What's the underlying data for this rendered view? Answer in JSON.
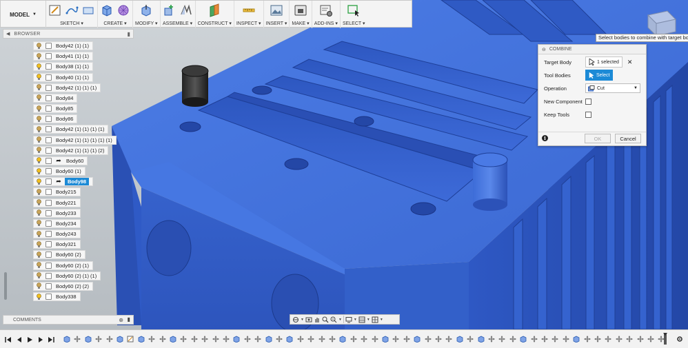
{
  "toolbar": {
    "workspace": "MODEL",
    "groups": [
      {
        "label": "SKETCH ▾"
      },
      {
        "label": "CREATE ▾"
      },
      {
        "label": "MODIFY ▾"
      },
      {
        "label": "ASSEMBLE ▾"
      },
      {
        "label": "CONSTRUCT ▾"
      },
      {
        "label": "INSPECT ▾"
      },
      {
        "label": "INSERT ▾"
      },
      {
        "label": "MAKE ▾"
      },
      {
        "label": "ADD-INS ▾"
      },
      {
        "label": "SELECT ▾"
      }
    ]
  },
  "browser": {
    "title": "BROWSER",
    "items": [
      {
        "label": "Body42 (1) (1)",
        "bulb": "off",
        "link": false,
        "selected": false
      },
      {
        "label": "Body41 (1) (1)",
        "bulb": "off",
        "link": false,
        "selected": false
      },
      {
        "label": "Body38 (1) (1)",
        "bulb": "on",
        "link": false,
        "selected": false
      },
      {
        "label": "Body40 (1) (1)",
        "bulb": "on",
        "link": false,
        "selected": false
      },
      {
        "label": "Body42 (1) (1) (1)",
        "bulb": "off",
        "link": false,
        "selected": false
      },
      {
        "label": "Body84",
        "bulb": "off",
        "link": false,
        "selected": false
      },
      {
        "label": "Body85",
        "bulb": "off",
        "link": false,
        "selected": false
      },
      {
        "label": "Body86",
        "bulb": "off",
        "link": false,
        "selected": false
      },
      {
        "label": "Body42 (1) (1) (1) (1)",
        "bulb": "off",
        "link": false,
        "selected": false
      },
      {
        "label": "Body42 (1) (1) (1) (1) (1)",
        "bulb": "off",
        "link": false,
        "selected": false
      },
      {
        "label": "Body42 (1) (1) (1) (2)",
        "bulb": "off",
        "link": false,
        "selected": false
      },
      {
        "label": "Body60",
        "bulb": "on",
        "link": true,
        "selected": false
      },
      {
        "label": "Body60 (1)",
        "bulb": "on",
        "link": false,
        "selected": false
      },
      {
        "label": "Body98",
        "bulb": "on",
        "link": true,
        "selected": true
      },
      {
        "label": "Body215",
        "bulb": "off",
        "link": false,
        "selected": false
      },
      {
        "label": "Body221",
        "bulb": "off",
        "link": false,
        "selected": false
      },
      {
        "label": "Body233",
        "bulb": "off",
        "link": false,
        "selected": false
      },
      {
        "label": "Body234",
        "bulb": "off",
        "link": false,
        "selected": false
      },
      {
        "label": "Body243",
        "bulb": "off",
        "link": false,
        "selected": false
      },
      {
        "label": "Body321",
        "bulb": "off",
        "link": false,
        "selected": false
      },
      {
        "label": "Body60 (2)",
        "bulb": "off",
        "link": false,
        "selected": false
      },
      {
        "label": "Body60 (2) (1)",
        "bulb": "off",
        "link": false,
        "selected": false
      },
      {
        "label": "Body60 (2) (1) (1)",
        "bulb": "off",
        "link": false,
        "selected": false
      },
      {
        "label": "Body60 (2) (2)",
        "bulb": "off",
        "link": false,
        "selected": false
      },
      {
        "label": "Body338",
        "bulb": "on",
        "link": false,
        "selected": false
      }
    ]
  },
  "comments": {
    "title": "COMMENTS"
  },
  "tooltip": "Select bodies to combine with target body",
  "combine": {
    "title": "COMBINE",
    "target_body_label": "Target Body",
    "target_body_value": "1 selected",
    "tool_bodies_label": "Tool Bodies",
    "tool_bodies_button": "Select",
    "operation_label": "Operation",
    "operation_value": "Cut",
    "new_component_label": "New Component",
    "keep_tools_label": "Keep Tools",
    "ok_label": "OK",
    "cancel_label": "Cancel"
  },
  "colors": {
    "model_blue": "#3f6fd8",
    "model_blue_dark": "#2447a6",
    "selection_blue": "#1c8ad6",
    "bulb_on": "#f2c01e",
    "bulb_off": "#c9a55a",
    "background_top": "#cfd4d8"
  },
  "icons": {
    "bulb": "lightbulb-icon",
    "body": "body-box-icon",
    "link": "link-arrow-icon",
    "info": "info-icon",
    "cursor": "cursor-icon",
    "viewcube": "viewcube-icon"
  }
}
